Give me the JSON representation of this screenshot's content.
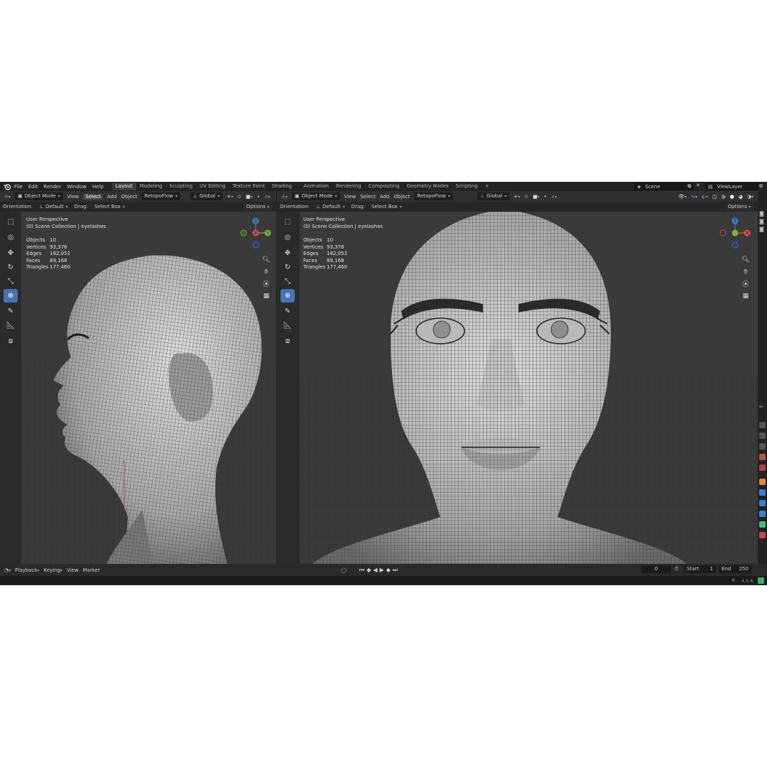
{
  "topbar": {
    "menus": [
      "File",
      "Edit",
      "Render",
      "Window",
      "Help"
    ],
    "workspaces": [
      "Layout",
      "Modeling",
      "Sculpting",
      "UV Editing",
      "Texture Paint",
      "Shading",
      "Animation",
      "Rendering",
      "Compositing",
      "Geometry Nodes",
      "Scripting"
    ],
    "active_workspace": "Layout",
    "add_tab": "+",
    "scene": "Scene",
    "view_layer": "ViewLayer"
  },
  "header": {
    "mode": "Object Mode",
    "view": "View",
    "select": "Select",
    "add": "Add",
    "object": "Object",
    "addon": "RetopoFlow",
    "transform": "Global"
  },
  "tool_settings": {
    "orientation_label": "Orientation:",
    "orientation_value": "Default",
    "drag_label": "Drag:",
    "drag_value": "Select Box",
    "options": "Options"
  },
  "viewport": {
    "perspective": "User Perspective",
    "collection": "(0) Scene Collection | eyelashes",
    "stats": [
      {
        "key": "Objects",
        "value": "10"
      },
      {
        "key": "Vertices",
        "value": "93,376"
      },
      {
        "key": "Edges",
        "value": "182,052"
      },
      {
        "key": "Faces",
        "value": "89,168"
      },
      {
        "key": "Triangles",
        "value": "177,460"
      }
    ],
    "gizmo_axes": {
      "x": "X",
      "y": "Y",
      "z": "Z"
    }
  },
  "timeline": {
    "playback": "Playback",
    "keying": "Keying",
    "view": "View",
    "marker": "Marker",
    "current_frame": "0",
    "start_label": "Start",
    "start_value": "1",
    "end_label": "End",
    "end_value": "250"
  },
  "statusbar": {
    "version": "4.5.6"
  },
  "colors": {
    "accent": "#4772b3",
    "axis_x": "#d94b55",
    "axis_y": "#79b33a",
    "axis_z": "#3d7ed8"
  }
}
